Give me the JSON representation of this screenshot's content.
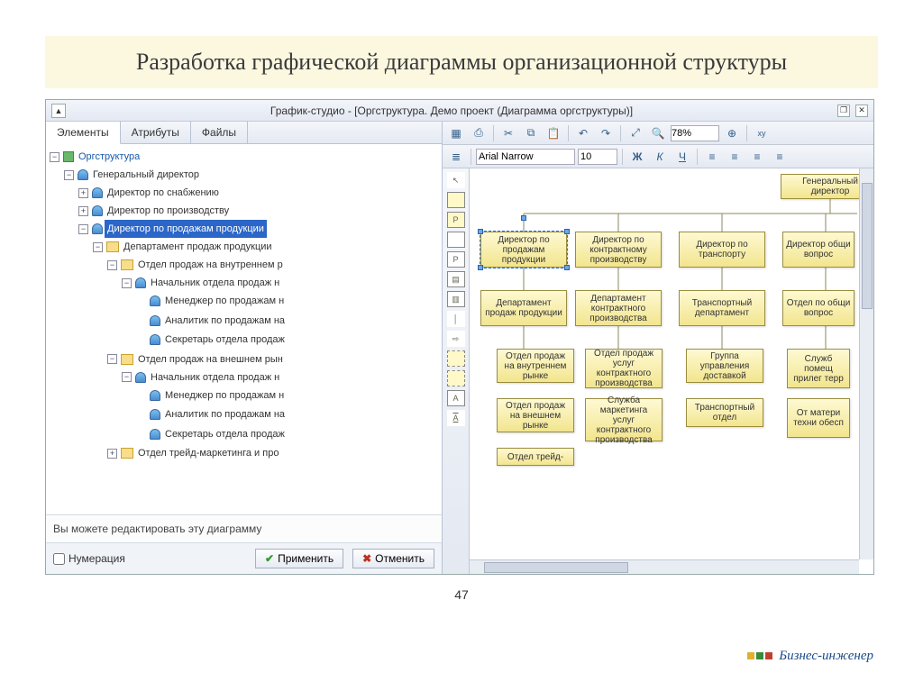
{
  "slide_title": "Разработка графической диаграммы организационной структуры",
  "window_title": "График-студио - [Оргструктура. Демо проект (Диаграмма оргструктуры)]",
  "tabs": {
    "t0": "Элементы",
    "t1": "Атрибуты",
    "t2": "Файлы"
  },
  "tree": {
    "root": "Оргструктура",
    "n1": "Генеральный директор",
    "n1a": "Директор по снабжению",
    "n1b": "Директор по производству",
    "n1c": "Директор по продажам продукции",
    "n1c1": "Департамент продаж продукции",
    "n1c1a": "Отдел продаж на внутреннем р",
    "n1c1a1": "Начальник отдела продаж н",
    "n1c1a1a": "Менеджер по продажам н",
    "n1c1a1b": "Аналитик по продажам на",
    "n1c1a1c": "Секретарь отдела продаж",
    "n1c1b": "Отдел продаж на внешнем рын",
    "n1c1b1": "Начальник отдела продаж н",
    "n1c1b1a": "Менеджер по продажам н",
    "n1c1b1b": "Аналитик по продажам на",
    "n1c1b1c": "Секретарь отдела продаж",
    "n1c1c": "Отдел трейд-маркетинга и про"
  },
  "hint": "Вы можете редактировать эту диаграмму",
  "numbering_label": "Нумерация",
  "apply_label": "Применить",
  "cancel_label": "Отменить",
  "zoom": "78%",
  "font_name": "Arial Narrow",
  "font_size": "10",
  "org": {
    "b0": "Генеральный директор",
    "b1": "Директор по продажам продукции",
    "b2": "Директор по контрактному производству",
    "b3": "Директор по транспорту",
    "b4": "Директор общи вопрос",
    "b5": "Департамент продаж продукции",
    "b6": "Департамент контрактного производства",
    "b7": "Транспортный департамент",
    "b8": "Отдел по общи вопрос",
    "b9": "Отдел продаж на внутреннем рынке",
    "b10": "Отдел продаж услуг контрактного производства",
    "b11": "Группа управления доставкой",
    "b12": "Служб помещ прилег терр",
    "b13": "Отдел продаж на внешнем рынке",
    "b14": "Служба маркетинга услуг контрактного производства",
    "b15": "Транспортный отдел",
    "b16": "От матери техни обесп",
    "b17": "Отдел трейд-"
  },
  "page_number": "47",
  "brand": "Бизнес-инженер"
}
